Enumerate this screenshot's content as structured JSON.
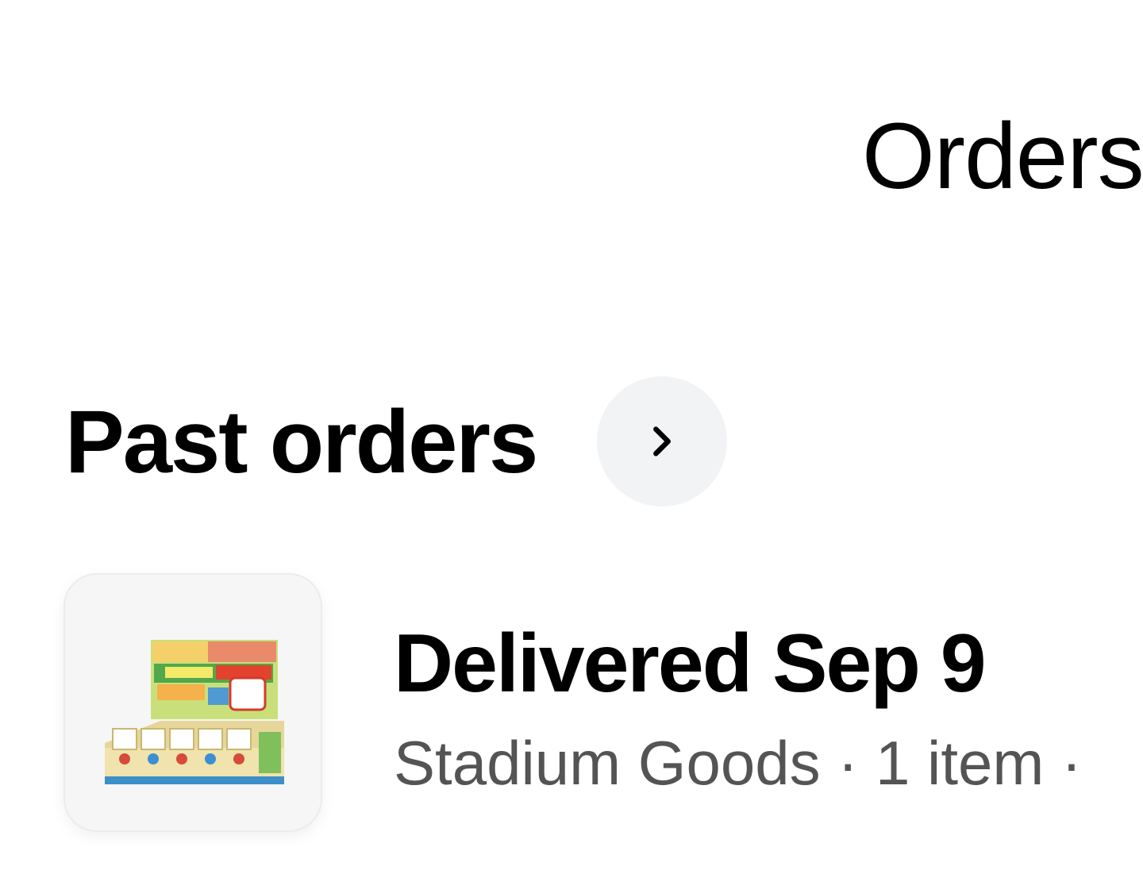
{
  "header": {
    "title": "Orders"
  },
  "past_orders": {
    "title": "Past orders",
    "chevron_icon": "chevron-right-icon",
    "items": [
      {
        "status": "Delivered Sep 9",
        "store": "Stadium Goods",
        "separator": "·",
        "count": "1 item",
        "trailing_separator": "·",
        "thumbnail": "product-box-image"
      }
    ]
  },
  "colors": {
    "chevron_bg": "#f2f3f5",
    "meta_text": "#545454",
    "thumb_bg": "#f6f6f6"
  }
}
